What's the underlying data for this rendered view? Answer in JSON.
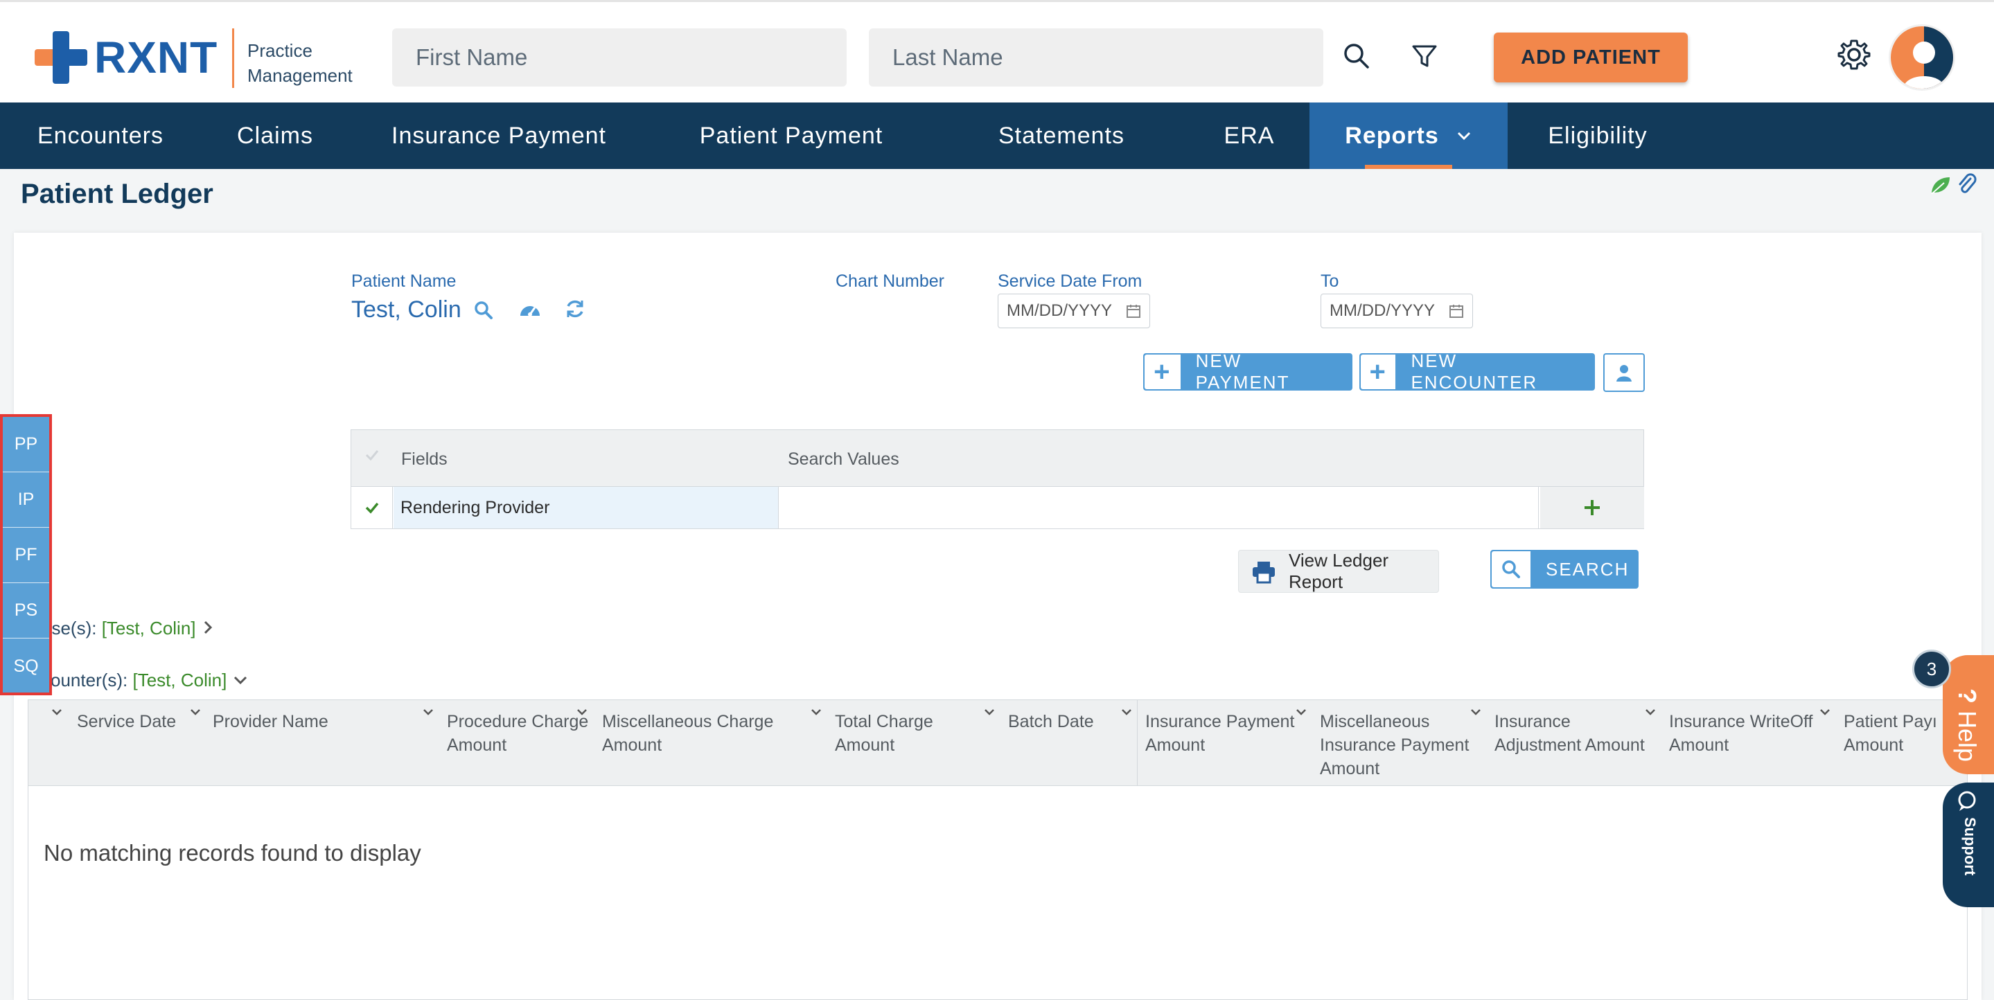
{
  "header": {
    "logo_text": "RXNT",
    "logo_sub_line1": "Practice",
    "logo_sub_line2": "Management",
    "first_name_placeholder": "First Name",
    "last_name_placeholder": "Last Name",
    "add_patient_label": "ADD PATIENT"
  },
  "nav": {
    "items": [
      {
        "label": "Encounters"
      },
      {
        "label": "Claims"
      },
      {
        "label": "Insurance Payment"
      },
      {
        "label": "Patient Payment"
      },
      {
        "label": "Statements"
      },
      {
        "label": "ERA"
      },
      {
        "label": "Reports"
      },
      {
        "label": "Eligibility"
      }
    ]
  },
  "page": {
    "title": "Patient Ledger"
  },
  "form": {
    "patient_name_label": "Patient Name",
    "patient_name_value": "Test, Colin",
    "chart_number_label": "Chart Number",
    "service_date_from_label": "Service Date From",
    "to_label": "To",
    "date_placeholder": "MM/DD/YYYY",
    "new_payment_label": "NEW PAYMENT",
    "new_encounter_label": "NEW ENCOUNTER"
  },
  "filters": {
    "fields_header": "Fields",
    "search_values_header": "Search Values",
    "rows": [
      {
        "field": "Rendering Provider",
        "value": ""
      }
    ]
  },
  "actions": {
    "view_ledger_label": "View Ledger Report",
    "search_label": "SEARCH"
  },
  "cases": {
    "cases_prefix": "ase(s): ",
    "cases_value": "[Test, Colin]",
    "encounters_prefix": "counter(s): ",
    "encounters_value": "[Test, Colin]"
  },
  "grid": {
    "columns": [
      {
        "line1": "Service Date",
        "line2": "",
        "line3": ""
      },
      {
        "line1": "Provider Name",
        "line2": "",
        "line3": ""
      },
      {
        "line1": "Procedure Charge",
        "line2": "Amount",
        "line3": ""
      },
      {
        "line1": "Miscellaneous Charge",
        "line2": "Amount",
        "line3": ""
      },
      {
        "line1": "Total Charge",
        "line2": "Amount",
        "line3": ""
      },
      {
        "line1": "Batch Date",
        "line2": "",
        "line3": ""
      },
      {
        "line1": "Insurance Payment",
        "line2": "Amount",
        "line3": ""
      },
      {
        "line1": "Miscellaneous",
        "line2": "Insurance Payment",
        "line3": "Amount"
      },
      {
        "line1": "Insurance",
        "line2": "Adjustment Amount",
        "line3": ""
      },
      {
        "line1": "Insurance WriteOff",
        "line2": "Amount",
        "line3": ""
      },
      {
        "line1": "Patient Payı",
        "line2": "Amount",
        "line3": ""
      }
    ],
    "empty_message": "No matching records found to display"
  },
  "quick_panel": {
    "items": [
      {
        "label": "PP"
      },
      {
        "label": "IP"
      },
      {
        "label": "PF"
      },
      {
        "label": "PS"
      },
      {
        "label": "SQ"
      }
    ]
  },
  "widgets": {
    "help_label": "Help",
    "help_badge": "3",
    "support_label": "Support"
  },
  "colors": {
    "brand_orange": "#f2874b",
    "brand_blue": "#1d5ea8",
    "nav_bg": "#123a5a",
    "nav_active": "#2769a8",
    "button_blue": "#4f9bd6",
    "green": "#3a8a2a"
  }
}
